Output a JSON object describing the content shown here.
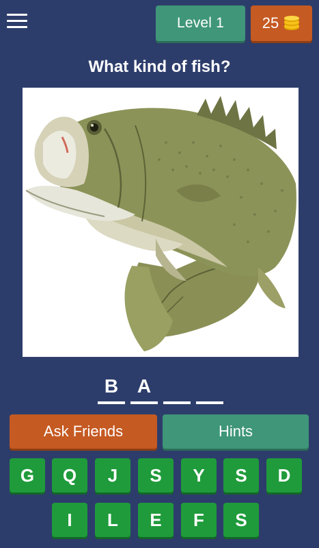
{
  "header": {
    "menu_icon": "hamburger-menu-icon",
    "level_label": "Level 1",
    "coins": "25",
    "coins_icon": "gold-coins-icon"
  },
  "question": "What kind of fish?",
  "picture": {
    "subject": "largemouth-bass-illustration"
  },
  "answer_slots": [
    "B",
    "A",
    "",
    ""
  ],
  "actions": {
    "ask_label": "Ask Friends",
    "hints_label": "Hints"
  },
  "keyboard": {
    "row1": [
      "G",
      "Q",
      "J",
      "S",
      "Y",
      "S",
      "D"
    ],
    "row2": [
      "I",
      "L",
      "E",
      "F",
      "S"
    ]
  },
  "colors": {
    "background": "#2d3d6b",
    "green_button": "#3f9679",
    "orange_button": "#c55a22",
    "letter_key": "#1f9b3b"
  }
}
